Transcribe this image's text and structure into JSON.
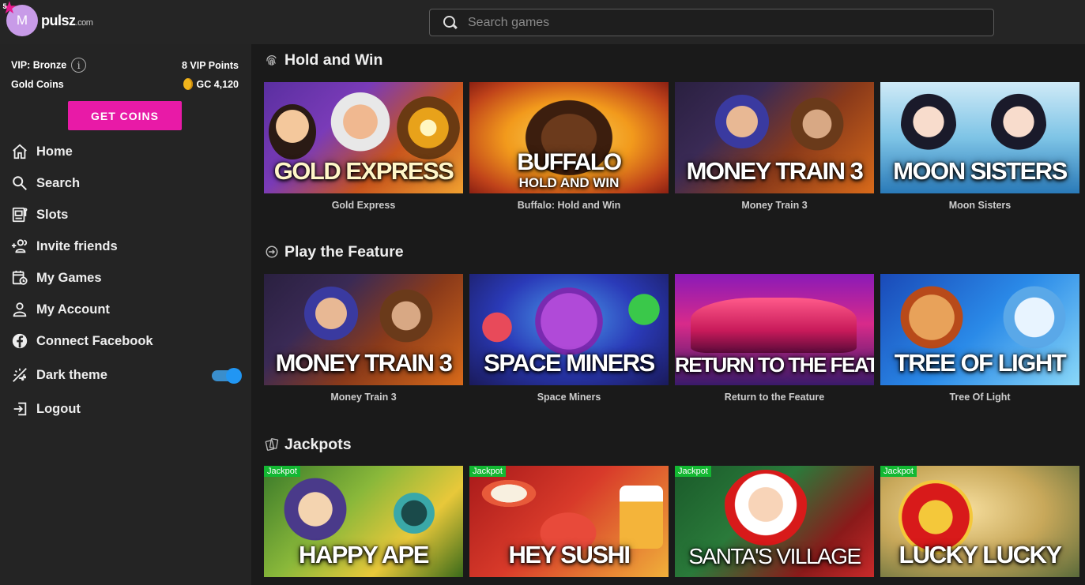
{
  "header": {
    "avatar_initial": "M",
    "level_badge": "5",
    "brand_name": "pulsz",
    "brand_tld": ".com",
    "search_placeholder": "Search games"
  },
  "sidebar": {
    "vip_label": "VIP: Bronze",
    "vip_points": "8 VIP Points",
    "gold_coins_label": "Gold Coins",
    "gold_coins_value": "GC 4,120",
    "get_coins_button": "GET COINS",
    "nav": [
      {
        "label": "Home",
        "icon": "home-icon"
      },
      {
        "label": "Search",
        "icon": "search-icon"
      },
      {
        "label": "Slots",
        "icon": "slot-machine-icon"
      },
      {
        "label": "Invite friends",
        "icon": "add-user-icon"
      },
      {
        "label": "My Games",
        "icon": "calendar-clock-icon"
      },
      {
        "label": "My Account",
        "icon": "person-icon"
      },
      {
        "label": "Connect Facebook",
        "icon": "facebook-icon"
      },
      {
        "label": "Dark theme",
        "icon": "theme-icon"
      },
      {
        "label": "Logout",
        "icon": "logout-icon"
      }
    ],
    "dark_theme_on": true
  },
  "sections": [
    {
      "title": "Hold and Win",
      "icon": "fingerprint-icon",
      "games": [
        {
          "name": "Gold Express",
          "logo": "GOLD EXPRESS",
          "jackpot": false
        },
        {
          "name": "Buffalo: Hold and Win",
          "logo": "BUFFALO",
          "logo2": "HOLD AND WIN",
          "jackpot": false
        },
        {
          "name": "Money Train 3",
          "logo": "MONEY TRAIN 3",
          "jackpot": false
        },
        {
          "name": "Moon Sisters",
          "logo": "MOON SISTERS",
          "jackpot": false
        }
      ]
    },
    {
      "title": "Play the Feature",
      "icon": "arrow-circle-icon",
      "games": [
        {
          "name": "Money Train 3",
          "logo": "MONEY TRAIN 3",
          "jackpot": false
        },
        {
          "name": "Space Miners",
          "logo": "SPACE MINERS",
          "jackpot": false
        },
        {
          "name": "Return to the Feature",
          "logo": "RETURN TO THE FEATURE",
          "jackpot": false
        },
        {
          "name": "Tree Of Light",
          "logo": "TREE OF LIGHT",
          "jackpot": false
        }
      ]
    },
    {
      "title": "Jackpots",
      "icon": "cards-icon",
      "games": [
        {
          "name": "Happy Ape",
          "logo": "HAPPY APE",
          "jackpot": true
        },
        {
          "name": "Hey Sushi",
          "logo": "HEY SUSHI",
          "jackpot": true
        },
        {
          "name": "Santa's Village",
          "logo": "SANTA'S VILLAGE",
          "jackpot": true
        },
        {
          "name": "Lucky Lucky",
          "logo": "LUCKY LUCKY",
          "jackpot": true
        }
      ]
    }
  ],
  "jackpot_tag": "Jackpot",
  "colors": {
    "accent": "#e81aa7",
    "jackpot_green": "#13b832",
    "toggle_blue": "#2196f3",
    "sidebar_bg": "#242424",
    "main_bg": "#1a1a1a"
  }
}
